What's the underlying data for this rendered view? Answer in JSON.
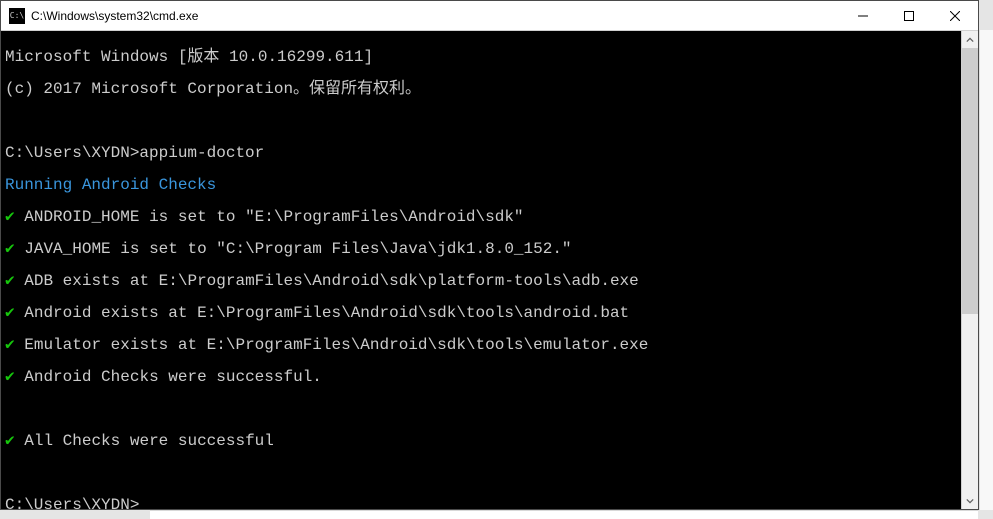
{
  "window": {
    "title": "C:\\Windows\\system32\\cmd.exe",
    "icon_label": "cmd-icon"
  },
  "terminal": {
    "header1": "Microsoft Windows [版本 10.0.16299.611]",
    "header2": "(c) 2017 Microsoft Corporation。保留所有权利。",
    "prompt1_path": "C:\\Users\\XYDN>",
    "prompt1_cmd": "appium-doctor",
    "running_line": "Running Android Checks",
    "checks": [
      " ANDROID_HOME is set to \"E:\\ProgramFiles\\Android\\sdk\"",
      " JAVA_HOME is set to \"C:\\Program Files\\Java\\jdk1.8.0_152.\"",
      " ADB exists at E:\\ProgramFiles\\Android\\sdk\\platform-tools\\adb.exe",
      " Android exists at E:\\ProgramFiles\\Android\\sdk\\tools\\android.bat",
      " Emulator exists at E:\\ProgramFiles\\Android\\sdk\\tools\\emulator.exe",
      " Android Checks were successful."
    ],
    "final_check": " All Checks were successful",
    "checkmark": "✔",
    "prompt2_path": "C:\\Users\\XYDN>"
  }
}
